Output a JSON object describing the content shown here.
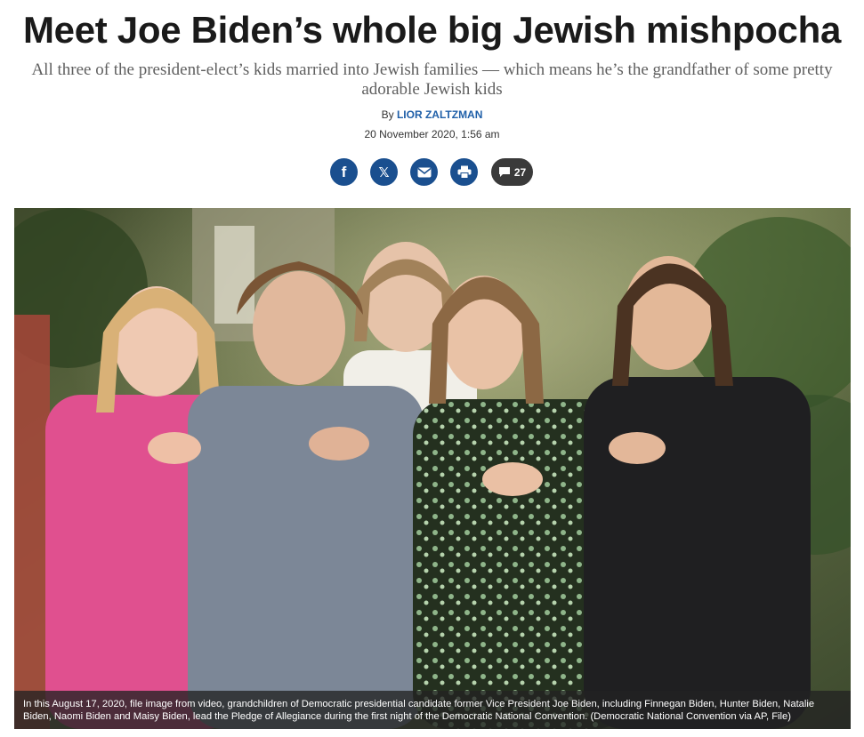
{
  "article": {
    "headline": "Meet Joe Biden’s whole big Jewish mishpocha",
    "subheadline": "All three of the president-elect’s kids married into Jewish families — which means he’s the grandfather of some pretty adorable Jewish kids",
    "byline_prefix": "By",
    "author": "LIOR ZALTZMAN",
    "date": "20 November 2020, 1:56 am"
  },
  "share": {
    "facebook_glyph": "f",
    "x_glyph": "𝕏",
    "comment_count": "27",
    "icons": [
      "facebook-icon",
      "x-icon",
      "email-icon",
      "print-icon",
      "comment-icon"
    ]
  },
  "photo": {
    "caption": "In this August 17, 2020, file image from video, grandchildren of Democratic presidential candidate former Vice President Joe Biden, including Finnegan Biden, Hunter Biden, Natalie Biden, Naomi Biden and Maisy Biden, lead the Pledge of Allegiance during the first night of the Democratic National Convention. (Democratic National Convention via AP, File)"
  },
  "colors": {
    "share_button": "#1a4f8f",
    "author_link": "#1f5fa8",
    "comments_pill": "#3a3a3a"
  }
}
